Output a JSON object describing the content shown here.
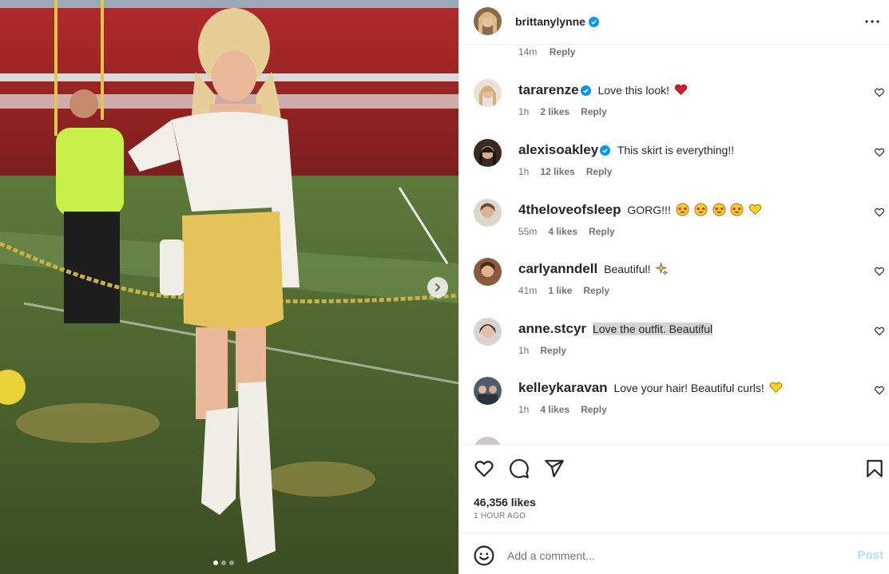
{
  "post": {
    "author": "brittanylynne",
    "author_verified": true,
    "previous_comment_meta": {
      "time": "14m",
      "reply_label": "Reply"
    },
    "likes_label": "46,356 likes",
    "time_label": "1 HOUR AGO",
    "carousel": {
      "total": 3,
      "current": 1
    }
  },
  "comments": [
    {
      "user": "tararenze",
      "verified": true,
      "text": "Love this look!",
      "emojis": [
        "red-heart"
      ],
      "time": "1h",
      "likes": "2 likes",
      "reply": "Reply"
    },
    {
      "user": "alexisoakley",
      "verified": true,
      "text": "This skirt is everything!!",
      "emojis": [],
      "time": "1h",
      "likes": "12 likes",
      "reply": "Reply"
    },
    {
      "user": "4theloveofsleep",
      "verified": false,
      "text": "GORG!!!",
      "emojis": [
        "star-eyes",
        "star-eyes",
        "star-eyes",
        "star-eyes",
        "yellow-heart"
      ],
      "time": "55m",
      "likes": "4 likes",
      "reply": "Reply"
    },
    {
      "user": "carlyanndell",
      "verified": false,
      "text": "Beautiful!",
      "emojis": [
        "sparkles"
      ],
      "time": "41m",
      "likes": "1 like",
      "reply": "Reply"
    },
    {
      "user": "anne.stcyr",
      "verified": false,
      "text": "Love the outfit. Beautiful",
      "emojis": [],
      "time": "1h",
      "likes": "",
      "reply": "Reply",
      "selected": true
    },
    {
      "user": "kelleykaravan",
      "verified": false,
      "text": "Love your hair! Beautiful curls!",
      "emojis": [
        "yellow-heart"
      ],
      "time": "1h",
      "likes": "4 likes",
      "reply": "Reply"
    }
  ],
  "composer": {
    "placeholder": "Add a comment...",
    "post_label": "Post"
  },
  "icons": {
    "header_more": "more-horizontal-icon",
    "like": "heart-icon",
    "comment": "comment-bubble-icon",
    "share": "send-icon",
    "save": "bookmark-icon",
    "emoji_picker": "smiley-icon",
    "carousel_next": "chevron-right-icon"
  },
  "colors": {
    "verified": "#0095f6",
    "post_button_disabled": "#b3dbff",
    "muted_text": "#737373"
  }
}
